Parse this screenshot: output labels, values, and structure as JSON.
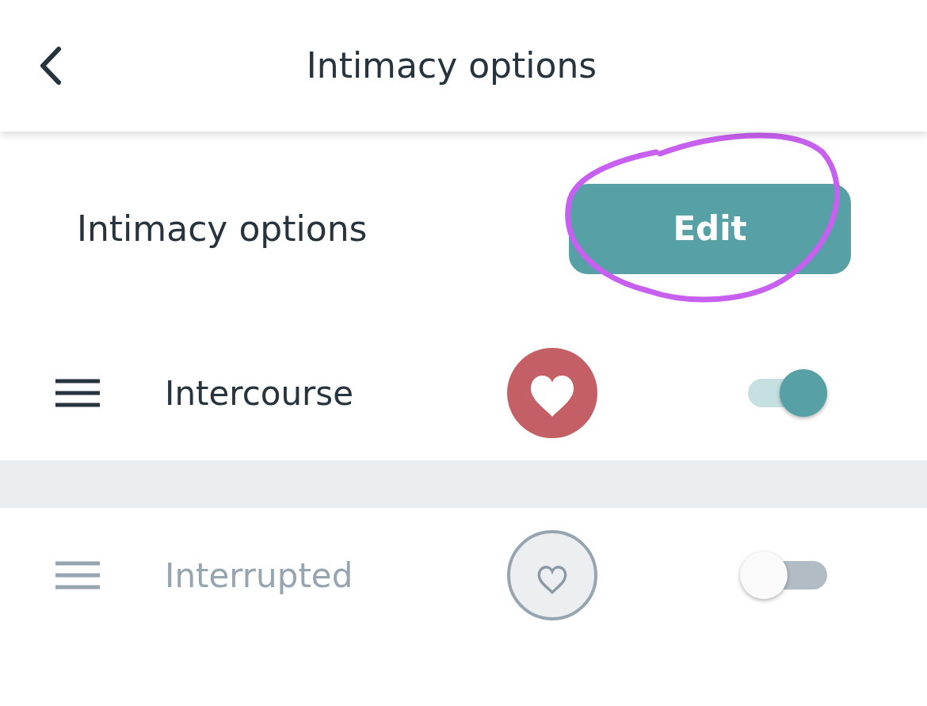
{
  "header": {
    "title": "Intimacy options"
  },
  "section": {
    "title": "Intimacy options",
    "button": "Edit",
    "annotation": {
      "kind": "circle",
      "color": "#c760f0"
    }
  },
  "options": [
    {
      "label": "Intercourse",
      "favorite": true,
      "on": true
    },
    {
      "label": "Interrupted",
      "favorite": false,
      "on": false
    }
  ]
}
